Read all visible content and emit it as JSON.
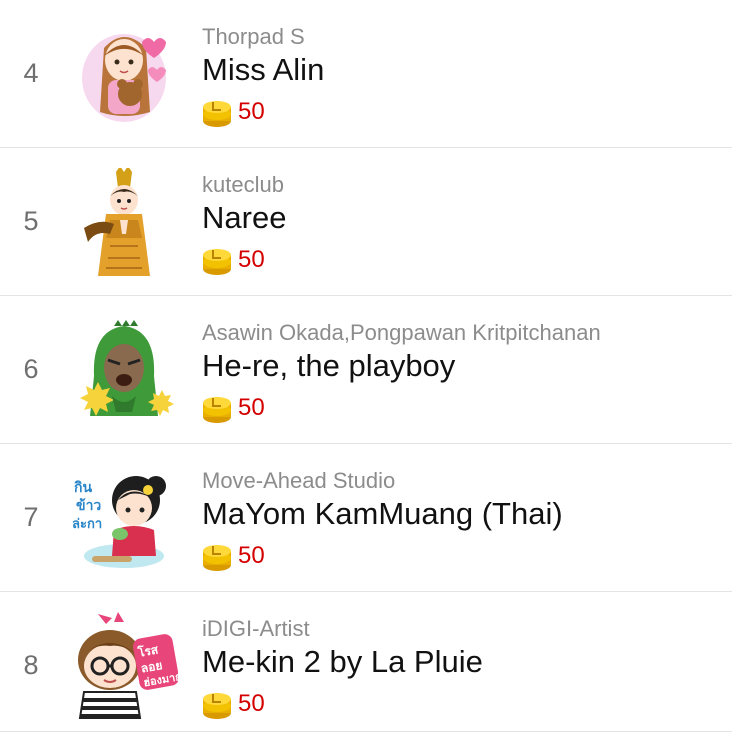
{
  "items": [
    {
      "rank": "4",
      "author": "Thorpad S",
      "title": "Miss Alin",
      "price": "50",
      "icon": "girl-with-teddy-bear-sticker"
    },
    {
      "rank": "5",
      "author": "kuteclub",
      "title": "Naree",
      "price": "50",
      "icon": "thai-dancer-sticker"
    },
    {
      "rank": "6",
      "author": "Asawin Okada,Pongpawan Kritpitchanan",
      "title": "He-re, the playboy",
      "price": "50",
      "icon": "green-dino-costume-sticker"
    },
    {
      "rank": "7",
      "author": "Move-Ahead Studio",
      "title": "MaYom KamMuang (Thai)",
      "price": "50",
      "icon": "girl-eating-sticker"
    },
    {
      "rank": "8",
      "author": "iDIGI-Artist",
      "title": "Me-kin 2 by La Pluie",
      "price": "50",
      "icon": "girl-with-glasses-sticker"
    }
  ],
  "colors": {
    "price": "#d40000",
    "coin": "#f2c200",
    "rank": "#6f6f6f",
    "author": "#8c8c8c"
  }
}
